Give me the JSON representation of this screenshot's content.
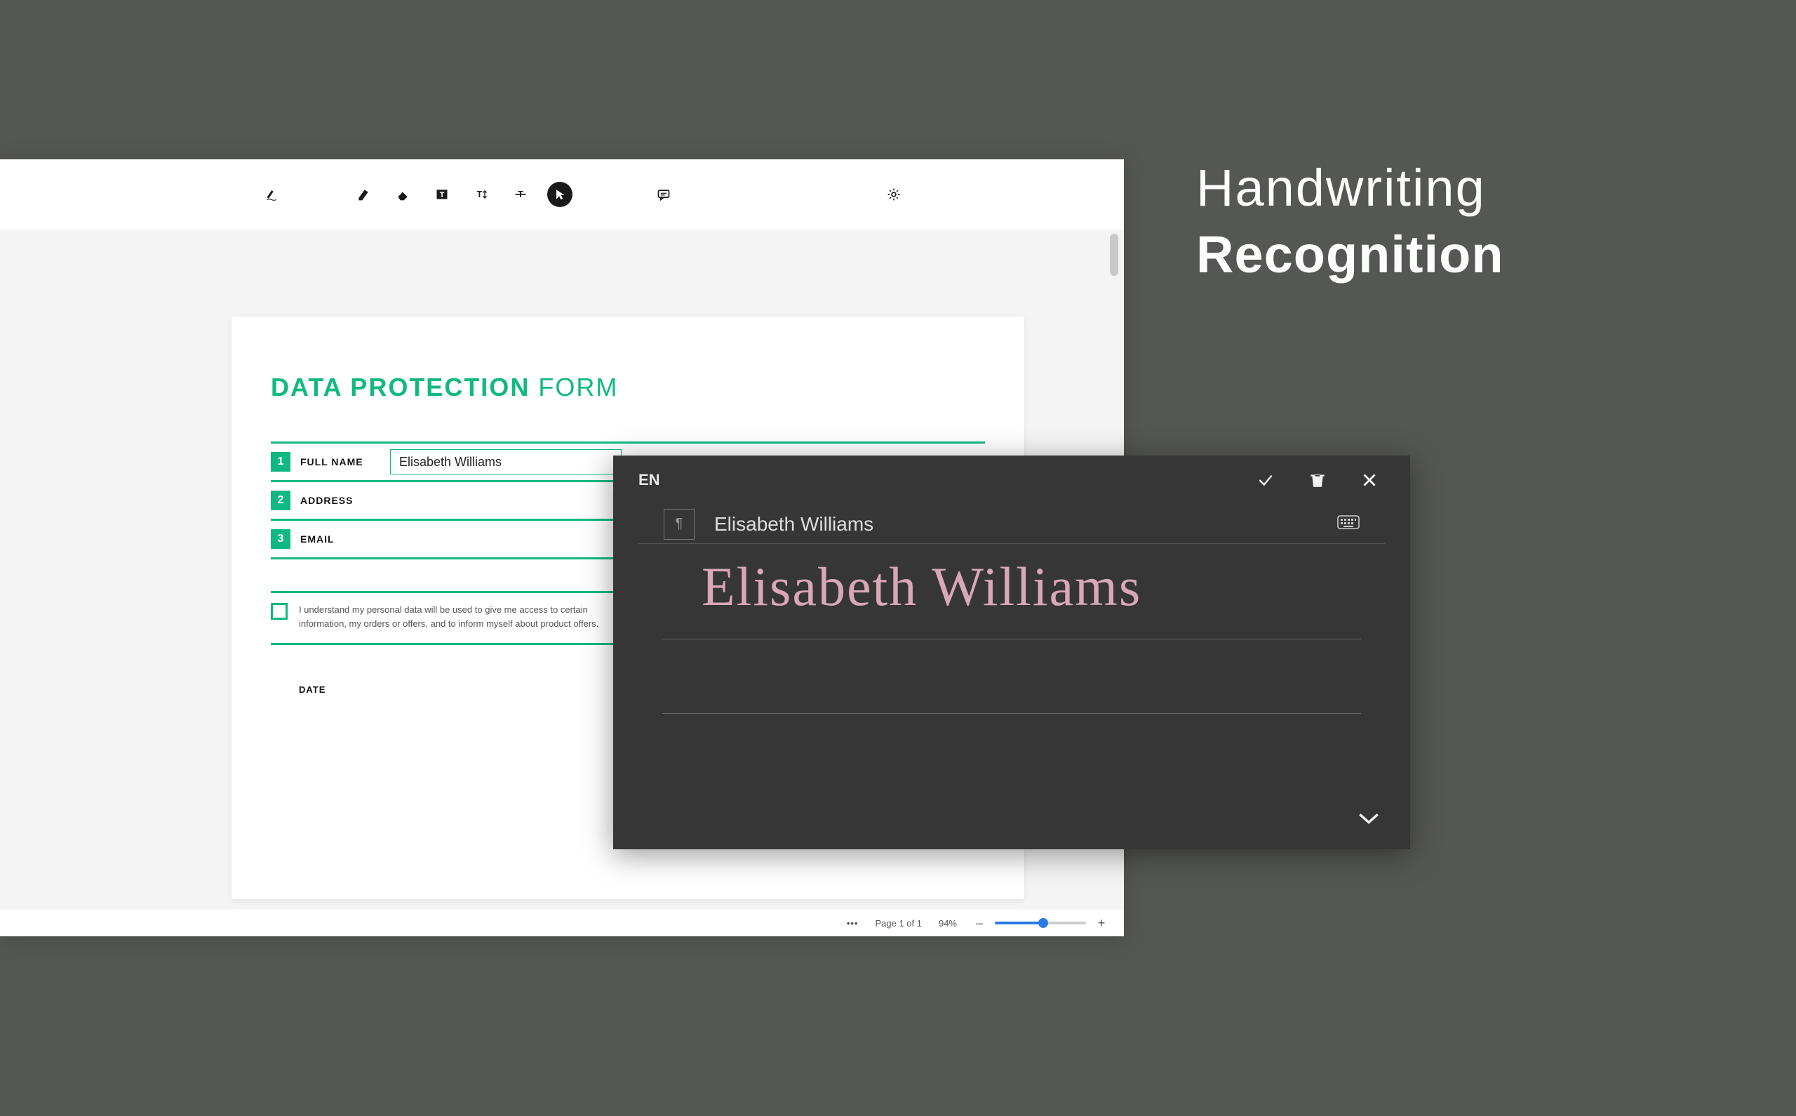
{
  "feature": {
    "line1": "Handwriting",
    "line2": "Recognition"
  },
  "window_controls": {
    "minimize": "–",
    "maximize": "□",
    "close": "×"
  },
  "toolbar": {
    "pen": "pen",
    "highlighter": "highlighter",
    "eraser": "eraser",
    "textbox": "T",
    "text_height": "text-height",
    "text_strike": "text-strike",
    "pointer": "pointer",
    "comment": "comment",
    "settings": "settings"
  },
  "document": {
    "title_bold": "DATA PROTECTION",
    "title_light": "FORM",
    "fields": [
      {
        "num": "1",
        "label": "FULL NAME",
        "value": "Elisabeth Williams"
      },
      {
        "num": "2",
        "label": "ADDRESS",
        "value": ""
      },
      {
        "num": "3",
        "label": "EMAIL",
        "value": ""
      }
    ],
    "consent": "I understand my personal data will be used to give me access to certain information, my orders or offers, and to inform myself about product offers.",
    "date_label": "DATE"
  },
  "statusbar": {
    "more": "•••",
    "page": "Page 1 of 1",
    "zoom": "94%",
    "minus": "–",
    "plus": "+"
  },
  "handwriting": {
    "lang": "EN",
    "glyph": "¶",
    "recognized": "Elisabeth Williams",
    "ink": "Elisabeth Williams"
  }
}
